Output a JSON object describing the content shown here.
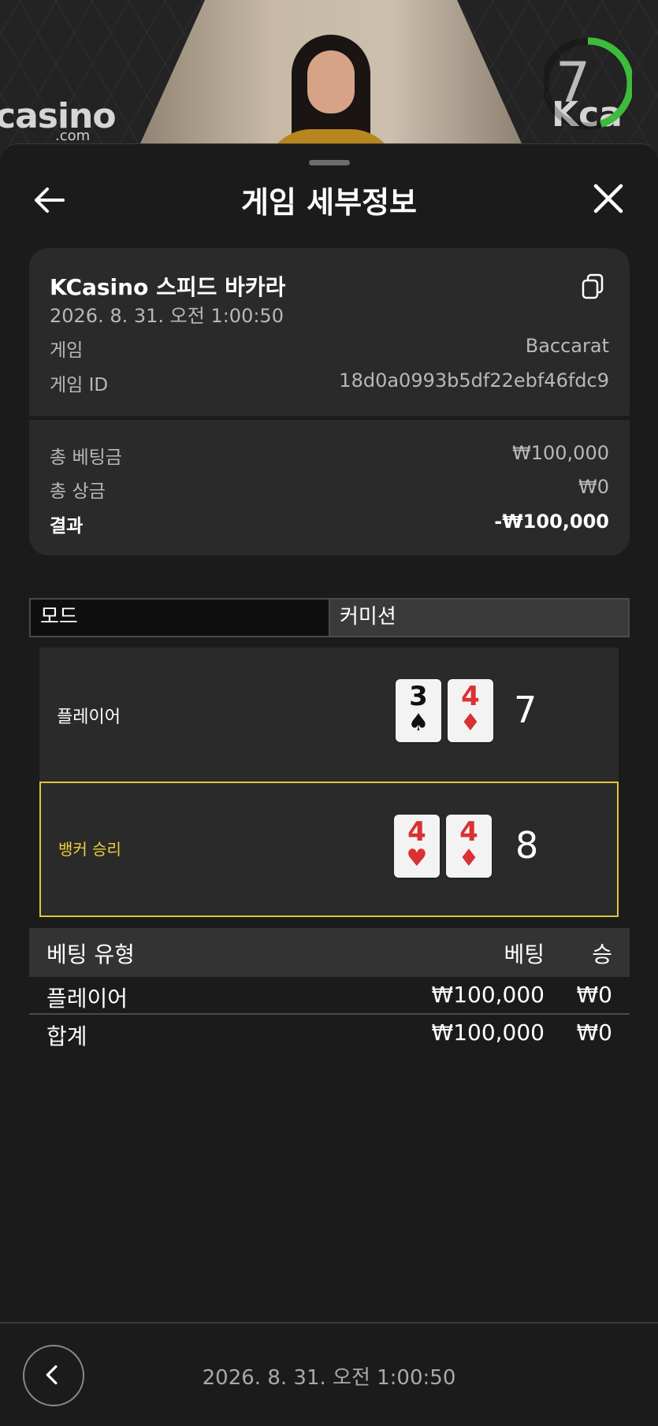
{
  "video": {
    "brand_left": "casino",
    "brand_left_sub": ".com",
    "brand_right": "Kca",
    "timer": "7",
    "timer_fraction": 0.45
  },
  "header": {
    "title": "게임 세부정보"
  },
  "summary": {
    "game_name": "KCasino 스피드 바카라",
    "date": "2026. 8. 31. 오전 1:00:50",
    "game_label": "게임",
    "game_value": "Baccarat",
    "game_id_label": "게임 ID",
    "game_id_value": "18d0a0993b5df22ebf46fdc9",
    "total_bet_label": "총 베팅금",
    "total_bet_value": "₩100,000",
    "total_win_label": "총 상금",
    "total_win_value": "₩0",
    "result_label": "결과",
    "result_value": "-₩100,000"
  },
  "tabs": [
    {
      "label": "모드"
    },
    {
      "label": "커미션"
    }
  ],
  "hands": {
    "player": {
      "label": "플레이어",
      "score": "7",
      "cards": [
        {
          "rank": "3",
          "suit": "♠",
          "color": "#111111"
        },
        {
          "rank": "4",
          "suit": "♦",
          "color": "#d83232"
        }
      ]
    },
    "banker": {
      "label": "뱅커 승리",
      "score": "8",
      "cards": [
        {
          "rank": "4",
          "suit": "♥",
          "color": "#d83232"
        },
        {
          "rank": "4",
          "suit": "♦",
          "color": "#d83232"
        }
      ]
    }
  },
  "bets": {
    "headers": {
      "type": "베팅 유형",
      "bet": "베팅",
      "win": "승"
    },
    "rows": [
      {
        "type": "플레이어",
        "bet": "₩100,000",
        "win": "₩0"
      }
    ],
    "total": {
      "type": "합계",
      "bet": "₩100,000",
      "win": "₩0"
    }
  },
  "footer": {
    "date": "2026. 8. 31. 오전 1:00:50"
  },
  "colors": {
    "background": "#1b1b1b",
    "card_bg": "#2a2a2a",
    "winner_border": "#e2c43a",
    "timer_green": "#3dbb3d"
  }
}
